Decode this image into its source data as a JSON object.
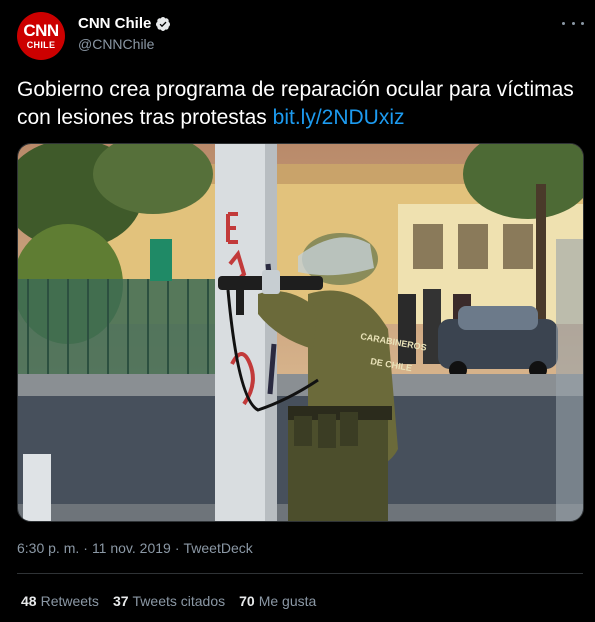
{
  "author": {
    "avatar_text": "CNN",
    "avatar_subtext": "CHILE",
    "name": "CNN Chile",
    "handle": "@CNNChile",
    "verified": true
  },
  "tweet": {
    "text": "Gobierno crea programa de reparación ocular para víctimas con lesiones tras protestas",
    "link": "bit.ly/2NDUxiz"
  },
  "photo": {
    "vest_text_1": "CARABINEROS",
    "vest_text_2": "DE CHILE"
  },
  "meta": {
    "time": "6:30 p. m.",
    "separator1": "·",
    "date": "11 nov. 2019",
    "separator2": "·",
    "source": "TweetDeck"
  },
  "stats": {
    "retweets_count": "48",
    "retweets_label": "Retweets",
    "quotes_count": "37",
    "quotes_label": "Tweets citados",
    "likes_count": "70",
    "likes_label": "Me gusta"
  },
  "colors": {
    "background": "#000000",
    "link": "#1d9bf0",
    "secondary_text": "#8b98a5",
    "avatar": "#cc0000"
  }
}
